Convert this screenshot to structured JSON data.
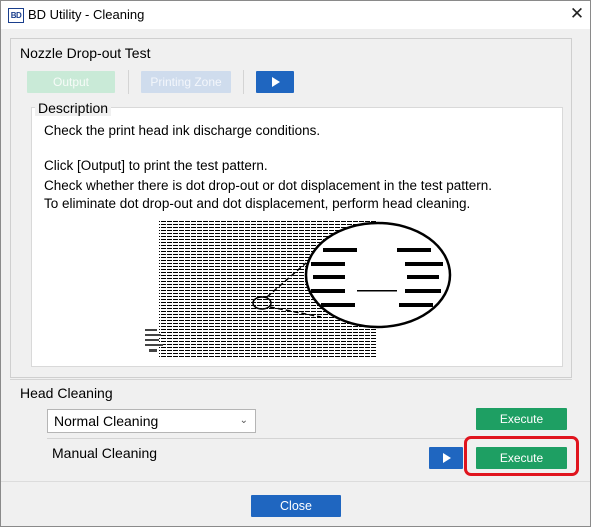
{
  "window": {
    "title": "BD Utility - Cleaning",
    "app_icon_text": "BD",
    "close_glyph": "✕"
  },
  "nozzle": {
    "title": "Nozzle Drop-out Test",
    "output_label": "Output",
    "printing_zone_label": "Printing Zone",
    "description": {
      "legend": "Description",
      "line1": "Check the print head ink discharge conditions.",
      "line2": "Click [Output] to print the test pattern.",
      "line3": "Check whether there is dot drop-out or dot displacement in the test pattern.",
      "line4": "To eliminate dot drop-out and dot displacement, perform head cleaning."
    }
  },
  "head_cleaning": {
    "title": "Head Cleaning",
    "mode_selected": "Normal Cleaning",
    "execute_label": "Execute",
    "manual_label": "Manual Cleaning",
    "manual_execute_label": "Execute"
  },
  "footer": {
    "close_label": "Close"
  },
  "colors": {
    "green": "#1e9f63",
    "blue": "#1f66c0",
    "highlight": "#e0141e"
  },
  "icons": {
    "play": "play-icon",
    "dropdown": "chevron-down-icon"
  }
}
